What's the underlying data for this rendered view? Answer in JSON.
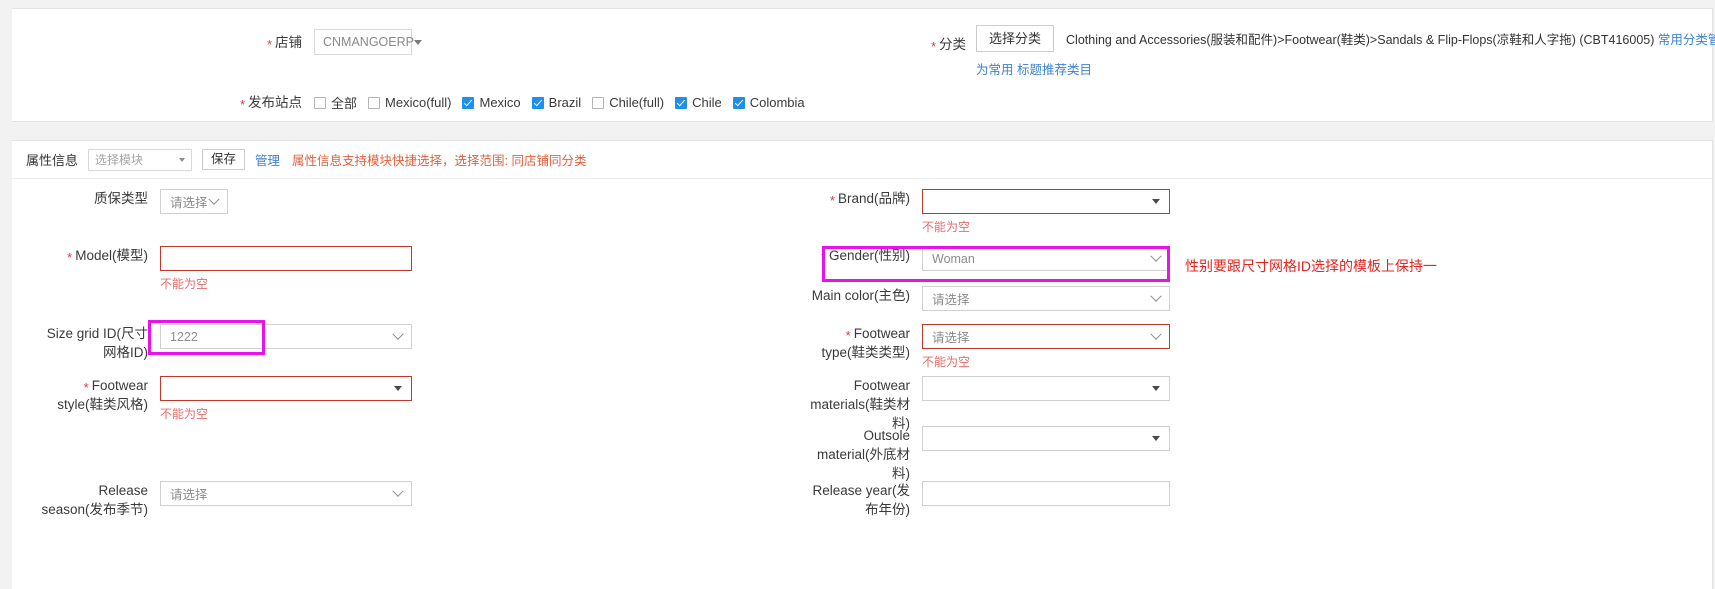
{
  "top": {
    "shop": {
      "label": "店铺",
      "required": true,
      "value": "CNMANGOERP"
    },
    "category": {
      "label": "分类",
      "required": true,
      "button": "选择分类",
      "path": "Clothing and Accessories(服装和配件)>Footwear(鞋类)>Sandals & Flip-Flops(凉鞋和人字拖) (CBT416005)",
      "manage_link": "常用分类管理",
      "sub_links": "为常用 标题推荐类目"
    },
    "sites": {
      "label": "发布站点",
      "required": true,
      "options": [
        {
          "label": "全部",
          "checked": false
        },
        {
          "label": "Mexico(full)",
          "checked": false
        },
        {
          "label": "Mexico",
          "checked": true
        },
        {
          "label": "Brazil",
          "checked": true
        },
        {
          "label": "Chile(full)",
          "checked": false
        },
        {
          "label": "Chile",
          "checked": true
        },
        {
          "label": "Colombia",
          "checked": true
        }
      ]
    }
  },
  "attr_toolbar": {
    "title": "属性信息",
    "module_placeholder": "选择模块",
    "save_label": "保存",
    "manage_label": "管理",
    "hint": "属性信息支持模块快捷选择，选择范围: 同店铺同分类"
  },
  "fields_left": [
    {
      "label": "质保类型",
      "required": false,
      "control": "select",
      "value": "请选择",
      "error": "",
      "highlight": false
    },
    {
      "label": "Model(模型)",
      "required": true,
      "control": "input",
      "value": "",
      "error": "不能为空",
      "highlight": false
    },
    {
      "label": "Size grid ID(尺寸网格ID)",
      "required": false,
      "control": "select",
      "value": "1222",
      "error": "",
      "highlight": true
    },
    {
      "label": "Footwear style(鞋类风格)",
      "required": true,
      "control": "select-caret",
      "value": "",
      "error": "不能为空",
      "highlight": false
    },
    {
      "label": "Release season(发布季节)",
      "required": false,
      "control": "select",
      "value": "请选择",
      "error": "",
      "highlight": false
    }
  ],
  "fields_right": [
    {
      "label": "Brand(品牌)",
      "required": true,
      "control": "select-caret",
      "value": "",
      "error": "不能为空",
      "highlight": false
    },
    {
      "label": "Gender(性别)",
      "required": true,
      "control": "select",
      "value": "Woman",
      "error": "",
      "highlight": true
    },
    {
      "label": "Main color(主色)",
      "required": false,
      "control": "select",
      "value": "请选择",
      "error": "",
      "highlight": false
    },
    {
      "label": "Footwear type(鞋类类型)",
      "required": true,
      "control": "select",
      "value": "请选择",
      "error": "不能为空",
      "highlight": false
    },
    {
      "label": "Footwear materials(鞋类材料)",
      "required": false,
      "control": "select-caret",
      "value": "",
      "error": "",
      "highlight": false
    },
    {
      "label": "Outsole material(外底材料)",
      "required": false,
      "control": "select-caret",
      "value": "",
      "error": "",
      "highlight": false
    },
    {
      "label": "Release year(发布年份)",
      "required": false,
      "control": "input",
      "value": "",
      "error": "",
      "highlight": false
    }
  ],
  "annotation": {
    "note": "性别要跟尺寸网格ID选择的模板上保持一",
    "color": "#ea12ea"
  }
}
